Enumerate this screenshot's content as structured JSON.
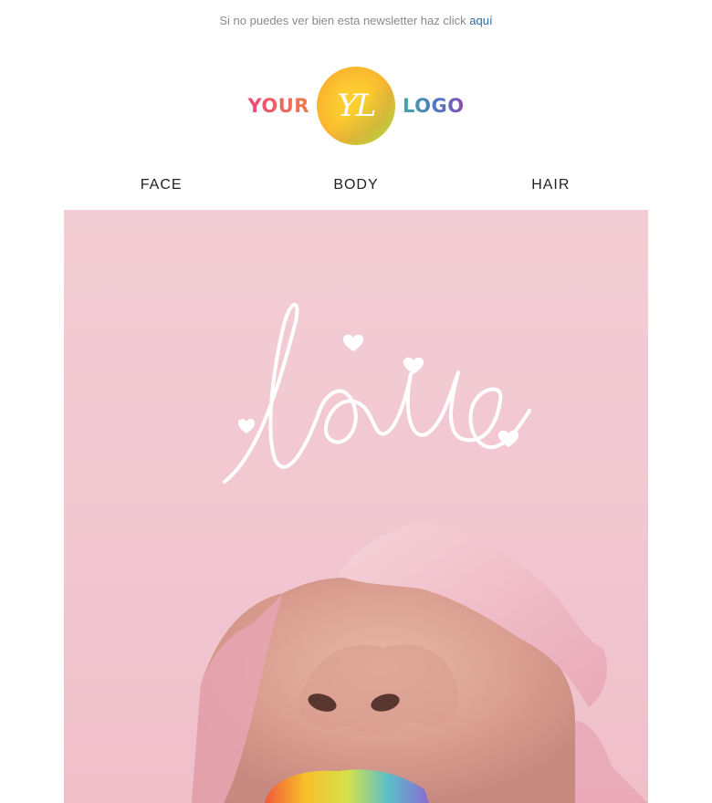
{
  "preheader": {
    "text": "Si no puedes ver bien esta newsletter haz click",
    "link_label": "aquí"
  },
  "logo": {
    "left_word": "YOUR",
    "monogram": "YL",
    "right_word": "LOGO"
  },
  "nav": {
    "items": [
      {
        "label": "FACE"
      },
      {
        "label": "BODY"
      },
      {
        "label": "HAIR"
      }
    ]
  },
  "hero": {
    "handwritten_text": "love"
  },
  "colors": {
    "link": "#2a6fa8",
    "hero_bg": "#f3cdd5",
    "text_muted": "#8a8a8a"
  }
}
